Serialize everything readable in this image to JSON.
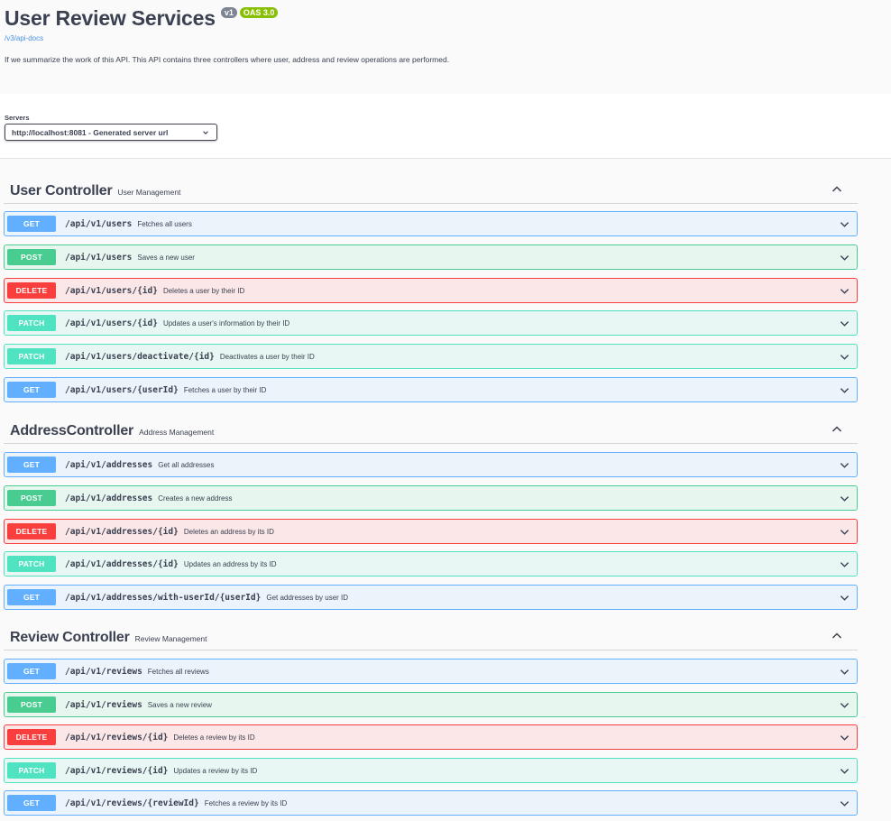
{
  "info": {
    "title": "User Review Services",
    "version_badge": "v1",
    "oas_badge": "OAS 3.0",
    "docs_link": "/v3/api-docs",
    "description": "If we summarize the work of this API. This API contains three controllers where user, address and review operations are performed."
  },
  "servers": {
    "label": "Servers",
    "selected": "http://localhost:8081 - Generated server url"
  },
  "tags": [
    {
      "name": "User Controller",
      "description": "User Management",
      "operations": [
        {
          "method": "GET",
          "path": "/api/v1/users",
          "summary": "Fetches all users"
        },
        {
          "method": "POST",
          "path": "/api/v1/users",
          "summary": "Saves a new user"
        },
        {
          "method": "DELETE",
          "path": "/api/v1/users/{id}",
          "summary": "Deletes a user by their ID"
        },
        {
          "method": "PATCH",
          "path": "/api/v1/users/{id}",
          "summary": "Updates a user's information by their ID"
        },
        {
          "method": "PATCH",
          "path": "/api/v1/users/deactivate/{id}",
          "summary": "Deactivates a user by their ID"
        },
        {
          "method": "GET",
          "path": "/api/v1/users/{userId}",
          "summary": "Fetches a user by their ID"
        }
      ]
    },
    {
      "name": "AddressController",
      "description": "Address Management",
      "operations": [
        {
          "method": "GET",
          "path": "/api/v1/addresses",
          "summary": "Get all addresses"
        },
        {
          "method": "POST",
          "path": "/api/v1/addresses",
          "summary": "Creates a new address"
        },
        {
          "method": "DELETE",
          "path": "/api/v1/addresses/{id}",
          "summary": "Deletes an address by its ID"
        },
        {
          "method": "PATCH",
          "path": "/api/v1/addresses/{id}",
          "summary": "Updates an address by its ID"
        },
        {
          "method": "GET",
          "path": "/api/v1/addresses/with-userId/{userId}",
          "summary": "Get addresses by user ID"
        }
      ]
    },
    {
      "name": "Review Controller",
      "description": "Review Management",
      "operations": [
        {
          "method": "GET",
          "path": "/api/v1/reviews",
          "summary": "Fetches all reviews"
        },
        {
          "method": "POST",
          "path": "/api/v1/reviews",
          "summary": "Saves a new review"
        },
        {
          "method": "DELETE",
          "path": "/api/v1/reviews/{id}",
          "summary": "Deletes a review by its ID"
        },
        {
          "method": "PATCH",
          "path": "/api/v1/reviews/{id}",
          "summary": "Updates a review by its ID"
        },
        {
          "method": "GET",
          "path": "/api/v1/reviews/{reviewId}",
          "summary": "Fetches a review by its ID"
        }
      ]
    }
  ],
  "icons": {
    "tag_toggle": "chevron-up-icon",
    "operation_toggle": "chevron-down-icon",
    "server_select": "chevron-down-icon"
  },
  "colors": {
    "get": "#61affe",
    "post": "#49cc90",
    "delete": "#f93e3e",
    "patch": "#50e3c2",
    "oas_badge": "#89bf04",
    "version_badge": "#7d8492"
  }
}
